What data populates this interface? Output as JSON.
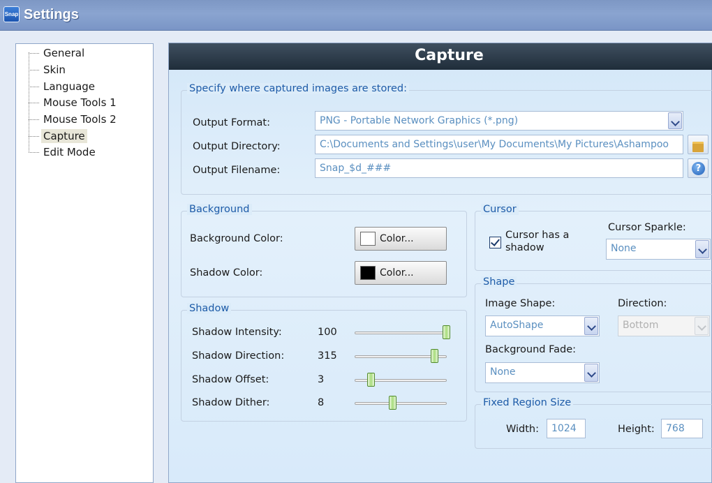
{
  "window": {
    "title": "Settings",
    "icon": "snap-app-icon",
    "icon_text": "Snap"
  },
  "sidebar": {
    "items": [
      {
        "label": "General"
      },
      {
        "label": "Skin"
      },
      {
        "label": "Language"
      },
      {
        "label": "Mouse Tools 1"
      },
      {
        "label": "Mouse Tools 2"
      },
      {
        "label": "Capture",
        "selected": true
      },
      {
        "label": "Edit Mode"
      }
    ]
  },
  "page": {
    "title": "Capture"
  },
  "storage": {
    "title": "Specify where captured images are stored:",
    "format_label": "Output Format:",
    "format_value": "PNG - Portable Network Graphics (*.png)",
    "directory_label": "Output Directory:",
    "directory_value": "C:\\Documents and Settings\\user\\My Documents\\My Pictures\\Ashampoo",
    "filename_label": "Output Filename:",
    "filename_value": "Snap_$d_###"
  },
  "background": {
    "title": "Background",
    "bg_color_label": "Background Color:",
    "bg_color_button": "Color...",
    "bg_swatch": "#ffffff",
    "shadow_color_label": "Shadow Color:",
    "shadow_color_button": "Color...",
    "shadow_swatch": "#000000"
  },
  "shadow": {
    "title": "Shadow",
    "sliders": [
      {
        "label": "Shadow Intensity:",
        "value": "100",
        "fraction": 1.0
      },
      {
        "label": "Shadow Direction:",
        "value": "315",
        "fraction": 0.875
      },
      {
        "label": "Shadow Offset:",
        "value": "3",
        "fraction": 0.15
      },
      {
        "label": "Shadow Dither:",
        "value": "8",
        "fraction": 0.4
      }
    ]
  },
  "cursor": {
    "title": "Cursor",
    "has_shadow_label": "Cursor has a shadow",
    "has_shadow_checked": true,
    "sparkle_label": "Cursor Sparkle:",
    "sparkle_value": "None"
  },
  "shape": {
    "title": "Shape",
    "image_shape_label": "Image Shape:",
    "image_shape_value": "AutoShape",
    "direction_label": "Direction:",
    "direction_value": "Bottom",
    "fade_label": "Background Fade:",
    "fade_value": "None"
  },
  "fixed_region": {
    "title": "Fixed Region Size",
    "width_label": "Width:",
    "width_value": "1024",
    "height_label": "Height:",
    "height_value": "768"
  }
}
